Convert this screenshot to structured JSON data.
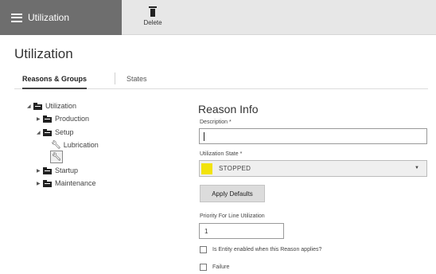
{
  "toolbar": {
    "module_label": "Utilization",
    "delete_label": "Delete"
  },
  "page": {
    "title": "Utilization"
  },
  "tabs": [
    {
      "label": "Reasons & Groups",
      "active": true
    },
    {
      "label": "States",
      "active": false
    }
  ],
  "tree": {
    "root": "Utilization",
    "children": [
      {
        "label": "Production",
        "expanded": false
      },
      {
        "label": "Setup",
        "expanded": true,
        "children": [
          {
            "label": "Lubrication"
          }
        ]
      },
      {
        "label": "Startup",
        "expanded": false
      },
      {
        "label": "Maintenance",
        "expanded": false
      }
    ]
  },
  "form": {
    "title": "Reason Info",
    "description_label": "Description *",
    "description_value": "",
    "state_label": "Utilization State *",
    "state_value": "STOPPED",
    "state_color": "#f2e30c",
    "apply_label": "Apply Defaults",
    "priority_label": "Priority For Line Utilization",
    "priority_value": "1",
    "checkbox_entity_label": "Is Entity enabled when this Reason applies?",
    "checkbox_failure_label": "Failure"
  }
}
